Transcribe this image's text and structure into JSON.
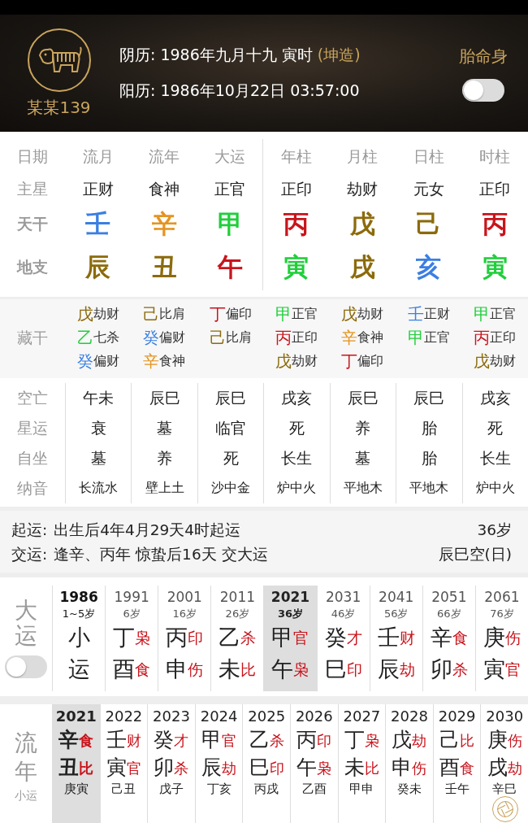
{
  "header": {
    "name": "某某139",
    "lunar_label": "阴历:",
    "lunar_value": "1986年九月十九 寅时",
    "lunar_tag": "(坤造)",
    "solar_label": "阳历:",
    "solar_value": "1986年10月22日 03:57:00",
    "toggle": {
      "label": "胎命身",
      "on": false
    }
  },
  "chart": {
    "labels": {
      "date": "日期",
      "main_star": "主星",
      "stem": "天干",
      "branch": "地支",
      "hidden": "藏干",
      "kongwang": "空亡",
      "xingyun": "星运",
      "zizuo": "自坐",
      "nayin": "纳音"
    },
    "flow_columns": [
      {
        "title": "流月",
        "main_star": "正财",
        "stem": {
          "char": "壬",
          "color": "#3b7fe2"
        },
        "branch": {
          "char": "辰",
          "color": "#8c6b0c"
        },
        "hidden": [
          {
            "char": "戊",
            "color": "#8c6b0c",
            "god": "劫财"
          },
          {
            "char": "乙",
            "color": "#1fcf3a",
            "god": "七杀"
          },
          {
            "char": "癸",
            "color": "#3b7fe2",
            "god": "偏财"
          }
        ],
        "kongwang": "午未",
        "xingyun": "衰",
        "zizuo": "墓",
        "nayin": "长流水"
      },
      {
        "title": "流年",
        "main_star": "食神",
        "stem": {
          "char": "辛",
          "color": "#e59420"
        },
        "branch": {
          "char": "丑",
          "color": "#8c6b0c"
        },
        "hidden": [
          {
            "char": "己",
            "color": "#8c6b0c",
            "god": "比肩"
          },
          {
            "char": "癸",
            "color": "#3b7fe2",
            "god": "偏财"
          },
          {
            "char": "辛",
            "color": "#e59420",
            "god": "食神"
          }
        ],
        "kongwang": "辰巳",
        "xingyun": "墓",
        "zizuo": "养",
        "nayin": "壁上土"
      },
      {
        "title": "大运",
        "main_star": "正官",
        "stem": {
          "char": "甲",
          "color": "#1fcf3a"
        },
        "branch": {
          "char": "午",
          "color": "#c8141c"
        },
        "hidden": [
          {
            "char": "丁",
            "color": "#c8141c",
            "god": "偏印"
          },
          {
            "char": "己",
            "color": "#8c6b0c",
            "god": "比肩"
          }
        ],
        "kongwang": "辰巳",
        "xingyun": "临官",
        "zizuo": "死",
        "nayin": "沙中金"
      }
    ],
    "natal_columns": [
      {
        "title": "年柱",
        "main_star": "正印",
        "stem": {
          "char": "丙",
          "color": "#c8141c"
        },
        "branch": {
          "char": "寅",
          "color": "#1fcf3a"
        },
        "hidden": [
          {
            "char": "甲",
            "color": "#1fcf3a",
            "god": "正官"
          },
          {
            "char": "丙",
            "color": "#c8141c",
            "god": "正印"
          },
          {
            "char": "戊",
            "color": "#8c6b0c",
            "god": "劫财"
          }
        ],
        "kongwang": "戌亥",
        "xingyun": "死",
        "zizuo": "长生",
        "nayin": "炉中火"
      },
      {
        "title": "月柱",
        "main_star": "劫财",
        "stem": {
          "char": "戊",
          "color": "#8c6b0c"
        },
        "branch": {
          "char": "戌",
          "color": "#8c6b0c"
        },
        "hidden": [
          {
            "char": "戊",
            "color": "#8c6b0c",
            "god": "劫财"
          },
          {
            "char": "辛",
            "color": "#e59420",
            "god": "食神"
          },
          {
            "char": "丁",
            "color": "#c8141c",
            "god": "偏印"
          }
        ],
        "kongwang": "辰巳",
        "xingyun": "养",
        "zizuo": "墓",
        "nayin": "平地木"
      },
      {
        "title": "日柱",
        "main_star": "元女",
        "stem": {
          "char": "己",
          "color": "#8c6b0c"
        },
        "branch": {
          "char": "亥",
          "color": "#3b7fe2"
        },
        "hidden": [
          {
            "char": "壬",
            "color": "#3b7fe2",
            "god": "正财"
          },
          {
            "char": "甲",
            "color": "#1fcf3a",
            "god": "正官"
          }
        ],
        "kongwang": "辰巳",
        "xingyun": "胎",
        "zizuo": "胎",
        "nayin": "平地木"
      },
      {
        "title": "时柱",
        "main_star": "正印",
        "stem": {
          "char": "丙",
          "color": "#c8141c"
        },
        "branch": {
          "char": "寅",
          "color": "#1fcf3a"
        },
        "hidden": [
          {
            "char": "甲",
            "color": "#1fcf3a",
            "god": "正官"
          },
          {
            "char": "丙",
            "color": "#c8141c",
            "god": "正印"
          },
          {
            "char": "戊",
            "color": "#8c6b0c",
            "god": "劫财"
          }
        ],
        "kongwang": "戌亥",
        "xingyun": "死",
        "zizuo": "长生",
        "nayin": "炉中火"
      }
    ]
  },
  "info": [
    {
      "label": "起运:",
      "text": "出生后4年4月29天4时起运",
      "right": "36岁"
    },
    {
      "label": "交运:",
      "text": "逢辛、丙年 惊蛰后16天 交大运",
      "right": "辰巳空(日)"
    }
  ],
  "dayun": {
    "label": "大运",
    "toggle": {
      "on": false
    },
    "items": [
      {
        "kind": "xiaoyun",
        "year": "1986",
        "age": "1~5岁",
        "stem": "小",
        "branch": "运",
        "selected": false
      },
      {
        "kind": "dayun",
        "year": "1991",
        "age": "6岁",
        "stem": "丁",
        "stem_god": "枭",
        "branch": "酉",
        "branch_god": "食",
        "selected": false
      },
      {
        "kind": "dayun",
        "year": "2001",
        "age": "16岁",
        "stem": "丙",
        "stem_god": "印",
        "branch": "申",
        "branch_god": "伤",
        "selected": false
      },
      {
        "kind": "dayun",
        "year": "2011",
        "age": "26岁",
        "stem": "乙",
        "stem_god": "杀",
        "branch": "未",
        "branch_god": "比",
        "selected": false
      },
      {
        "kind": "dayun",
        "year": "2021",
        "age": "36岁",
        "stem": "甲",
        "stem_god": "官",
        "branch": "午",
        "branch_god": "枭",
        "selected": true
      },
      {
        "kind": "dayun",
        "year": "2031",
        "age": "46岁",
        "stem": "癸",
        "stem_god": "才",
        "branch": "巳",
        "branch_god": "印",
        "selected": false
      },
      {
        "kind": "dayun",
        "year": "2041",
        "age": "56岁",
        "stem": "壬",
        "stem_god": "财",
        "branch": "辰",
        "branch_god": "劫",
        "selected": false
      },
      {
        "kind": "dayun",
        "year": "2051",
        "age": "66岁",
        "stem": "辛",
        "stem_god": "食",
        "branch": "卯",
        "branch_god": "杀",
        "selected": false
      },
      {
        "kind": "dayun",
        "year": "2061",
        "age": "76岁",
        "stem": "庚",
        "stem_god": "伤",
        "branch": "寅",
        "branch_god": "官",
        "selected": false
      }
    ]
  },
  "liunian": {
    "label": "流年",
    "sublabel": "小运",
    "items": [
      {
        "year": "2021",
        "stem": "辛",
        "stem_god": "食",
        "branch": "丑",
        "branch_god": "比",
        "xiaoyun": "庚寅",
        "selected": true
      },
      {
        "year": "2022",
        "stem": "壬",
        "stem_god": "财",
        "branch": "寅",
        "branch_god": "官",
        "xiaoyun": "己丑",
        "selected": false
      },
      {
        "year": "2023",
        "stem": "癸",
        "stem_god": "才",
        "branch": "卯",
        "branch_god": "杀",
        "xiaoyun": "戊子",
        "selected": false
      },
      {
        "year": "2024",
        "stem": "甲",
        "stem_god": "官",
        "branch": "辰",
        "branch_god": "劫",
        "xiaoyun": "丁亥",
        "selected": false
      },
      {
        "year": "2025",
        "stem": "乙",
        "stem_god": "杀",
        "branch": "巳",
        "branch_god": "印",
        "xiaoyun": "丙戌",
        "selected": false
      },
      {
        "year": "2026",
        "stem": "丙",
        "stem_god": "印",
        "branch": "午",
        "branch_god": "枭",
        "xiaoyun": "乙酉",
        "selected": false
      },
      {
        "year": "2027",
        "stem": "丁",
        "stem_god": "枭",
        "branch": "未",
        "branch_god": "比",
        "xiaoyun": "甲申",
        "selected": false
      },
      {
        "year": "2028",
        "stem": "戊",
        "stem_god": "劫",
        "branch": "申",
        "branch_god": "伤",
        "xiaoyun": "癸未",
        "selected": false
      },
      {
        "year": "2029",
        "stem": "己",
        "stem_god": "比",
        "branch": "酉",
        "branch_god": "食",
        "xiaoyun": "壬午",
        "selected": false
      },
      {
        "year": "2030",
        "stem": "庚",
        "stem_god": "伤",
        "branch": "戌",
        "branch_god": "劫",
        "xiaoyun": "辛巳",
        "selected": false
      }
    ]
  }
}
